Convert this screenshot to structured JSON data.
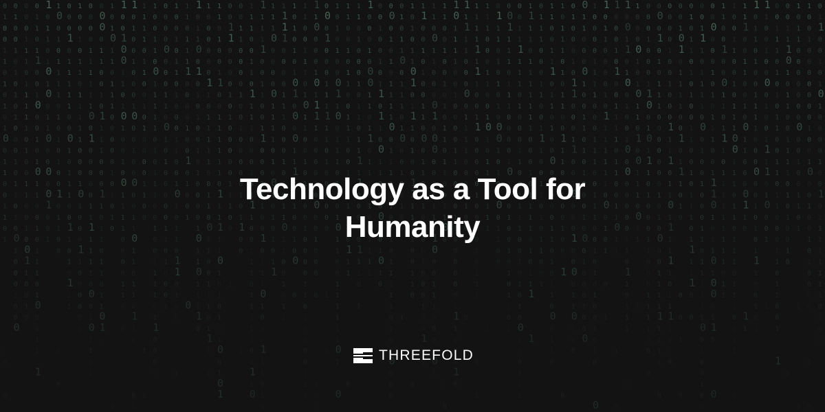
{
  "title": {
    "line1": "Technology as a Tool for",
    "line2": "Humanity"
  },
  "brand": {
    "name": "THREEFOLD",
    "icon": "threefold-logo-icon"
  },
  "background": {
    "pattern": "binary-digit-rain",
    "base_color": "#131313",
    "digit_color": "#5f8c78"
  }
}
